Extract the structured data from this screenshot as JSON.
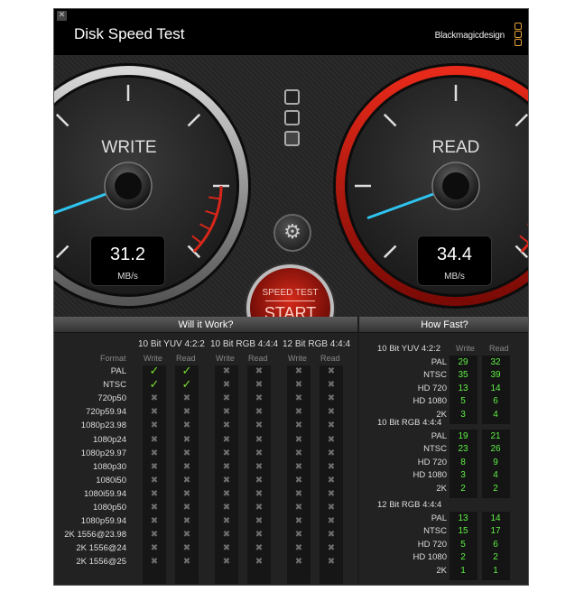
{
  "app": {
    "title": "Disk Speed Test",
    "brand": "Blackmagicdesign",
    "close_glyph": "✕"
  },
  "colors": {
    "accent_red": "#cc1a10",
    "needle": "#2ec4f0",
    "ok_green": "#79e02e",
    "speed_green": "#5ef045"
  },
  "gauges": {
    "write": {
      "label": "WRITE",
      "value": "31.2",
      "unit": "MB/s",
      "ring": "gray"
    },
    "read": {
      "label": "READ",
      "value": "34.4",
      "unit": "MB/s",
      "ring": "red"
    }
  },
  "controls": {
    "start_top": "SPEED TEST",
    "start_main": "START",
    "gear_glyph": "⚙",
    "size_buttons": 3
  },
  "will_it_work": {
    "title": "Will it Work?",
    "format_header": "Format",
    "col_write": "Write",
    "col_read": "Read",
    "groups": [
      "10 Bit YUV 4:2:2",
      "10 Bit RGB 4:4:4",
      "12 Bit RGB 4:4:4"
    ],
    "rows": [
      {
        "format": "PAL",
        "marks": [
          1,
          1,
          0,
          0,
          0,
          0
        ]
      },
      {
        "format": "NTSC",
        "marks": [
          1,
          1,
          0,
          0,
          0,
          0
        ]
      },
      {
        "format": "720p50",
        "marks": [
          0,
          0,
          0,
          0,
          0,
          0
        ]
      },
      {
        "format": "720p59.94",
        "marks": [
          0,
          0,
          0,
          0,
          0,
          0
        ]
      },
      {
        "format": "1080p23.98",
        "marks": [
          0,
          0,
          0,
          0,
          0,
          0
        ]
      },
      {
        "format": "1080p24",
        "marks": [
          0,
          0,
          0,
          0,
          0,
          0
        ]
      },
      {
        "format": "1080p29.97",
        "marks": [
          0,
          0,
          0,
          0,
          0,
          0
        ]
      },
      {
        "format": "1080p30",
        "marks": [
          0,
          0,
          0,
          0,
          0,
          0
        ]
      },
      {
        "format": "1080i50",
        "marks": [
          0,
          0,
          0,
          0,
          0,
          0
        ]
      },
      {
        "format": "1080i59.94",
        "marks": [
          0,
          0,
          0,
          0,
          0,
          0
        ]
      },
      {
        "format": "1080p50",
        "marks": [
          0,
          0,
          0,
          0,
          0,
          0
        ]
      },
      {
        "format": "1080p59.94",
        "marks": [
          0,
          0,
          0,
          0,
          0,
          0
        ]
      },
      {
        "format": "2K 1556@23.98",
        "marks": [
          0,
          0,
          0,
          0,
          0,
          0
        ]
      },
      {
        "format": "2K 1556@24",
        "marks": [
          0,
          0,
          0,
          0,
          0,
          0
        ]
      },
      {
        "format": "2K 1556@25",
        "marks": [
          0,
          0,
          0,
          0,
          0,
          0
        ]
      }
    ],
    "check_glyph": "✓",
    "cross_glyph": "✖"
  },
  "how_fast": {
    "title": "How Fast?",
    "col_write": "Write",
    "col_read": "Read",
    "groups": [
      {
        "name": "10 Bit YUV 4:2:2",
        "rows": [
          {
            "label": "PAL",
            "write": "29",
            "read": "32"
          },
          {
            "label": "NTSC",
            "write": "35",
            "read": "39"
          },
          {
            "label": "HD 720",
            "write": "13",
            "read": "14"
          },
          {
            "label": "HD 1080",
            "write": "5",
            "read": "6"
          },
          {
            "label": "2K",
            "write": "3",
            "read": "4"
          }
        ]
      },
      {
        "name": "10 Bit RGB 4:4:4",
        "rows": [
          {
            "label": "PAL",
            "write": "19",
            "read": "21"
          },
          {
            "label": "NTSC",
            "write": "23",
            "read": "26"
          },
          {
            "label": "HD 720",
            "write": "8",
            "read": "9"
          },
          {
            "label": "HD 1080",
            "write": "3",
            "read": "4"
          },
          {
            "label": "2K",
            "write": "2",
            "read": "2"
          }
        ]
      },
      {
        "name": "12 Bit RGB 4:4:4",
        "rows": [
          {
            "label": "PAL",
            "write": "13",
            "read": "14"
          },
          {
            "label": "NTSC",
            "write": "15",
            "read": "17"
          },
          {
            "label": "HD 720",
            "write": "5",
            "read": "6"
          },
          {
            "label": "HD 1080",
            "write": "2",
            "read": "2"
          },
          {
            "label": "2K",
            "write": "1",
            "read": "1"
          }
        ]
      }
    ]
  }
}
